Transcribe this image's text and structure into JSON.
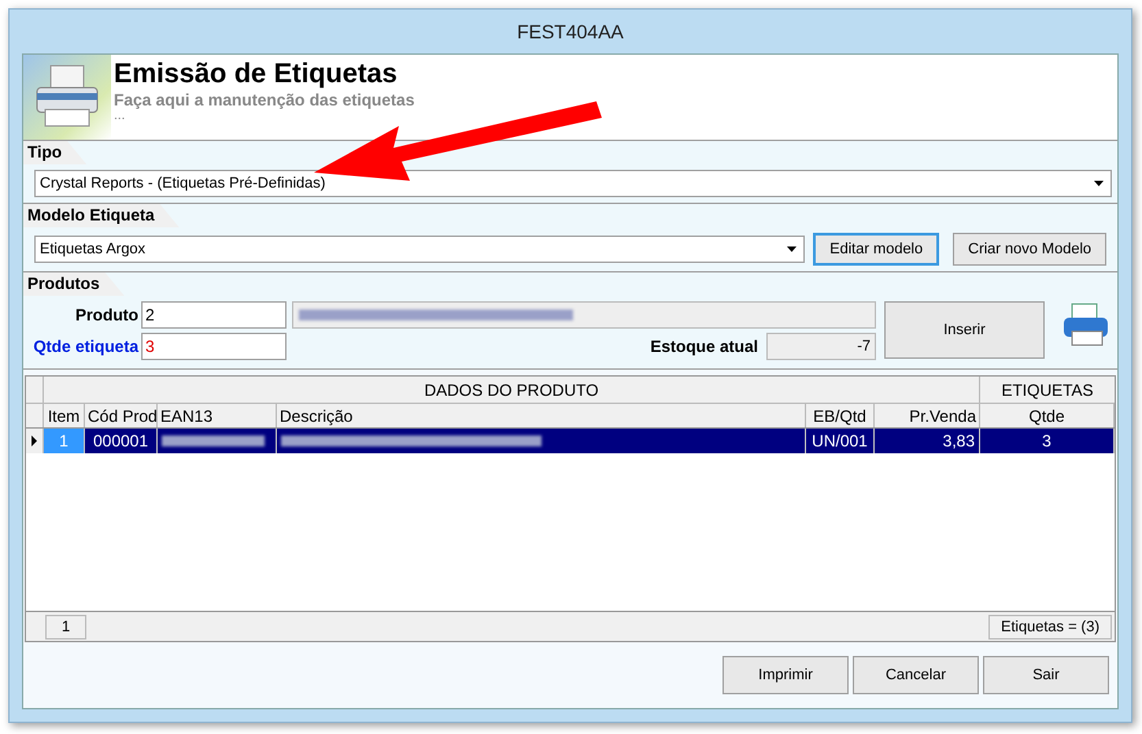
{
  "window": {
    "title": "FEST404AA"
  },
  "header": {
    "title": "Emissão de Etiquetas",
    "subtitle": "Faça aqui a manutenção das etiquetas",
    "ellipsis": "..."
  },
  "tipo": {
    "label": "Tipo",
    "value": "Crystal Reports - (Etiquetas Pré-Definidas)"
  },
  "modelo": {
    "label": "Modelo Etiqueta",
    "value": "Etiquetas Argox",
    "buttons": [
      {
        "label": "Editar modelo",
        "focused": true
      },
      {
        "label": "Criar novo Modelo",
        "focused": false
      }
    ]
  },
  "produtos": {
    "label": "Produtos",
    "produto_label": "Produto",
    "produto_value": "2",
    "qtde_label": "Qtde etiqueta",
    "qtde_value": "3",
    "estoque_label": "Estoque atual",
    "estoque_value": "-7",
    "insert_button": "Inserir"
  },
  "table": {
    "groups": [
      {
        "label": "DADOS DO PRODUTO"
      },
      {
        "label": "ETIQUETAS"
      }
    ],
    "columns": [
      "Item",
      "Cód Prod",
      "EAN13",
      "Descrição",
      "EB/Qtd",
      "Pr.Venda",
      "Qtde"
    ],
    "rows": [
      {
        "selected": true,
        "cells": [
          "1",
          "000001",
          "",
          "",
          "UN/001",
          "3,83",
          "3"
        ]
      }
    ],
    "footer_count": "1",
    "footer_total": "Etiquetas  = (3)"
  },
  "buttons": [
    "Imprimir",
    "Cancelar",
    "Sair"
  ]
}
